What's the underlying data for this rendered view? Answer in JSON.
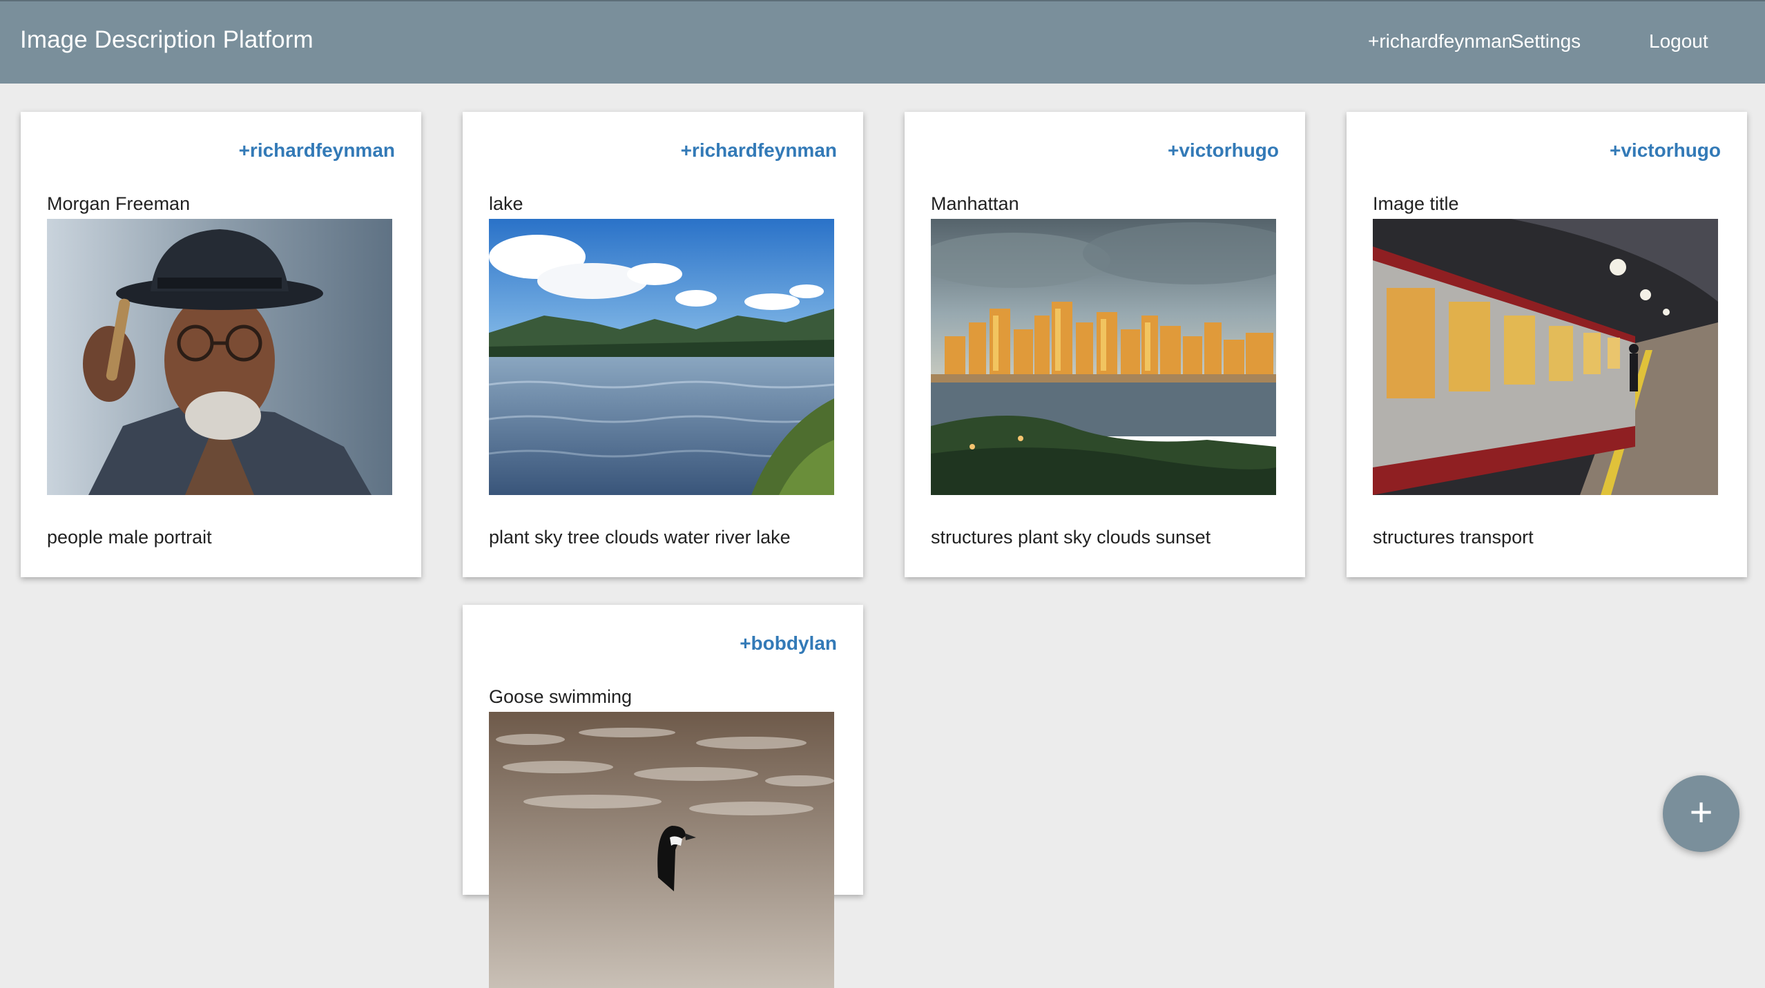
{
  "header": {
    "brand": "Image Description Platform",
    "user_link": "+richardfeynman",
    "settings_label": "Settings",
    "logout_label": "Logout",
    "background_color": "#7a8f9b"
  },
  "cards": [
    {
      "author": "+richardfeynman",
      "title": "Morgan Freeman",
      "tags": "people male portrait"
    },
    {
      "author": "+richardfeynman",
      "title": "lake",
      "tags": "plant sky tree clouds water river lake"
    },
    {
      "author": "+victorhugo",
      "title": "Manhattan",
      "tags": "structures plant sky clouds sunset"
    },
    {
      "author": "+victorhugo",
      "title": "Image title",
      "tags": "structures transport"
    },
    {
      "author": "+bobdylan",
      "title": "Goose swimming",
      "tags": ""
    }
  ],
  "fab": {
    "icon": "plus-icon",
    "symbol": "+"
  },
  "colors": {
    "author_link": "#337ab7",
    "page_background": "#ececec"
  }
}
